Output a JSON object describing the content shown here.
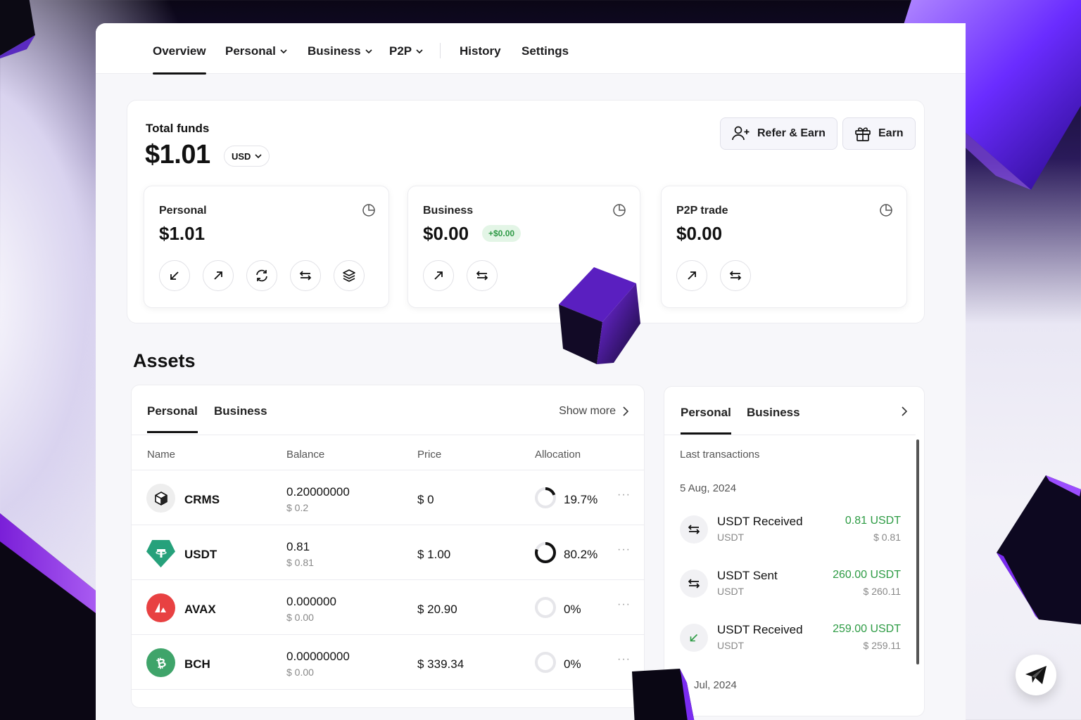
{
  "nav": {
    "items": [
      {
        "label": "Overview",
        "active": true
      },
      {
        "label": "Personal",
        "dropdown": true
      },
      {
        "label": "Business",
        "dropdown": true
      },
      {
        "label": "P2P",
        "dropdown": true
      },
      {
        "label": "History"
      },
      {
        "label": "Settings"
      }
    ]
  },
  "funds": {
    "title": "Total funds",
    "amount": "$1.01",
    "currency": "USD",
    "refer_label": "Refer & Earn",
    "earn_label": "Earn"
  },
  "wallets": [
    {
      "title": "Personal",
      "amount": "$1.01",
      "actions": [
        "receive-icon",
        "send-icon",
        "swap-icon",
        "transfer-icon",
        "stake-icon"
      ]
    },
    {
      "title": "Business",
      "amount": "$0.00",
      "badge": "+$0.00",
      "actions": [
        "send-icon",
        "transfer-icon"
      ]
    },
    {
      "title": "P2P trade",
      "amount": "$0.00",
      "actions": [
        "send-icon",
        "transfer-icon"
      ]
    }
  ],
  "assets": {
    "heading": "Assets",
    "tabs": [
      "Personal",
      "Business"
    ],
    "show_more": "Show more",
    "columns": [
      "Name",
      "Balance",
      "Price",
      "Allocation"
    ],
    "rows": [
      {
        "name": "CRMS",
        "balance": "0.20000000",
        "balance_usd": "$ 0.2",
        "price": "$ 0",
        "allocation": "19.7%",
        "alloc_value": 0.197,
        "icon": "crms-cube-icon",
        "color": "#eeeeee"
      },
      {
        "name": "USDT",
        "balance": "0.81",
        "balance_usd": "$ 0.81",
        "price": "$ 1.00",
        "allocation": "80.2%",
        "alloc_value": 0.802,
        "icon": "tether-icon",
        "color": "#26a17b"
      },
      {
        "name": "AVAX",
        "balance": "0.000000",
        "balance_usd": "$ 0.00",
        "price": "$ 20.90",
        "allocation": "0%",
        "alloc_value": 0,
        "icon": "avalanche-icon",
        "color": "#e84142"
      },
      {
        "name": "BCH",
        "balance": "0.00000000",
        "balance_usd": "$ 0.00",
        "price": "$ 339.34",
        "allocation": "0%",
        "alloc_value": 0,
        "icon": "bitcoin-cash-icon",
        "color": "#3fa46a"
      }
    ]
  },
  "transactions": {
    "tabs": [
      "Personal",
      "Business"
    ],
    "title": "Last transactions",
    "groups": [
      {
        "date": "5 Aug, 2024",
        "items": [
          {
            "title": "USDT Received",
            "sub": "USDT",
            "amount": "0.81 USDT",
            "usd": "$ 0.81",
            "icon": "transfer-icon"
          },
          {
            "title": "USDT Sent",
            "sub": "USDT",
            "amount": "260.00 USDT",
            "usd": "$ 260.11",
            "icon": "transfer-icon"
          },
          {
            "title": "USDT Received",
            "sub": "USDT",
            "amount": "259.00 USDT",
            "usd": "$ 259.11",
            "icon": "receive-icon"
          }
        ]
      },
      {
        "date": "Jul, 2024",
        "items": []
      }
    ]
  },
  "colors": {
    "accent": "#111111",
    "positive": "#2d9b44",
    "badge_bg": "#e3f5e6",
    "brand_purple": "#7b2cf0"
  }
}
